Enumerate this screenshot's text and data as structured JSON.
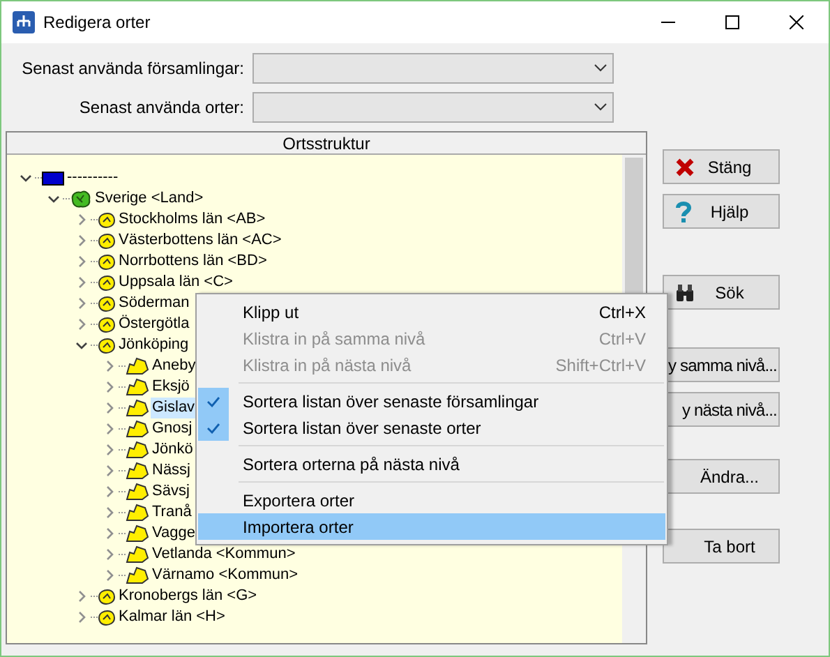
{
  "window": {
    "title": "Redigera orter"
  },
  "fields": [
    {
      "label": "Senast använda församlingar:"
    },
    {
      "label": "Senast använda orter:"
    }
  ],
  "tree": {
    "header": "Ortsstruktur",
    "items": [
      {
        "label": "----------",
        "kind": "flag",
        "expanded": true,
        "selected": false,
        "children": [
          {
            "label": "Sverige <Land>",
            "kind": "country",
            "expanded": true,
            "selected": false,
            "children": [
              {
                "label": "Stockholms län <AB>",
                "kind": "county",
                "expanded": false,
                "selected": false
              },
              {
                "label": "Västerbottens län <AC>",
                "kind": "county",
                "expanded": false,
                "selected": false
              },
              {
                "label": "Norrbottens län <BD>",
                "kind": "county",
                "expanded": false,
                "selected": false
              },
              {
                "label": "Uppsala län <C>",
                "kind": "county",
                "expanded": false,
                "selected": false
              },
              {
                "label": "Söderman",
                "kind": "county",
                "expanded": false,
                "selected": false
              },
              {
                "label": "Östergötla",
                "kind": "county",
                "expanded": false,
                "selected": false
              },
              {
                "label": "Jönköping",
                "kind": "county",
                "expanded": true,
                "selected": false,
                "children": [
                  {
                    "label": "Aneby",
                    "kind": "municipality",
                    "expanded": false,
                    "selected": false
                  },
                  {
                    "label": "Eksjö",
                    "kind": "municipality",
                    "expanded": false,
                    "selected": false
                  },
                  {
                    "label": "Gislav",
                    "kind": "municipality",
                    "expanded": false,
                    "selected": true
                  },
                  {
                    "label": "Gnosj",
                    "kind": "municipality",
                    "expanded": false,
                    "selected": false
                  },
                  {
                    "label": "Jönkö",
                    "kind": "municipality",
                    "expanded": false,
                    "selected": false
                  },
                  {
                    "label": "Nässj",
                    "kind": "municipality",
                    "expanded": false,
                    "selected": false
                  },
                  {
                    "label": "Sävsj",
                    "kind": "municipality",
                    "expanded": false,
                    "selected": false
                  },
                  {
                    "label": "Tranå",
                    "kind": "municipality",
                    "expanded": false,
                    "selected": false
                  },
                  {
                    "label": "Vagge",
                    "kind": "municipality",
                    "expanded": false,
                    "selected": false
                  },
                  {
                    "label": "Vetlanda <Kommun>",
                    "kind": "municipality",
                    "expanded": false,
                    "selected": false
                  },
                  {
                    "label": "Värnamo <Kommun>",
                    "kind": "municipality",
                    "expanded": false,
                    "selected": false
                  }
                ]
              },
              {
                "label": "Kronobergs län <G>",
                "kind": "county",
                "expanded": false,
                "selected": false
              },
              {
                "label": "Kalmar län <H>",
                "kind": "county",
                "expanded": false,
                "selected": false
              }
            ]
          }
        ]
      }
    ]
  },
  "buttons": [
    {
      "label": "Stäng",
      "kind": "close"
    },
    {
      "label": "Hjälp",
      "kind": "help"
    },
    {
      "label": "Sök",
      "kind": "search"
    },
    {
      "label": "y samma nivå...",
      "kind": "partial"
    },
    {
      "label": "y nästa nivå...",
      "kind": "partial"
    },
    {
      "label": "Ändra...",
      "kind": "plain"
    },
    {
      "label": "Ta bort",
      "kind": "plain"
    }
  ],
  "context_menu": {
    "groups": [
      [
        {
          "label": "Klipp ut",
          "shortcut": "Ctrl+X",
          "disabled": false,
          "checked": false,
          "selected": false
        },
        {
          "label": "Klistra in på samma nivå",
          "shortcut": "Ctrl+V",
          "disabled": true,
          "checked": false,
          "selected": false
        },
        {
          "label": "Klistra in på nästa nivå",
          "shortcut": "Shift+Ctrl+V",
          "disabled": true,
          "checked": false,
          "selected": false
        }
      ],
      [
        {
          "label": "Sortera listan över senaste församlingar",
          "disabled": false,
          "checked": true,
          "selected": false
        },
        {
          "label": "Sortera listan över senaste orter",
          "disabled": false,
          "checked": true,
          "selected": false
        }
      ],
      [
        {
          "label": "Sortera orterna på nästa nivå",
          "disabled": false,
          "checked": false,
          "selected": false
        }
      ],
      [
        {
          "label": "Exportera orter",
          "disabled": false,
          "checked": false,
          "selected": false
        },
        {
          "label": "Importera orter",
          "disabled": false,
          "checked": false,
          "selected": true
        }
      ]
    ]
  }
}
